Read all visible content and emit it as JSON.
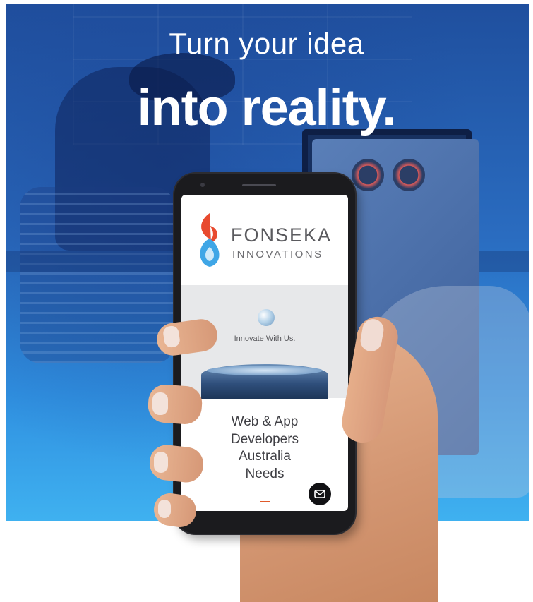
{
  "hero": {
    "line1": "Turn your idea",
    "line2": "into reality."
  },
  "phone_screen": {
    "brand_name": "FONSEKA",
    "brand_sub": "INNOVATIONS",
    "tagline": "Innovate With Us.",
    "headline_lines": [
      "Web & App",
      "Developers",
      "Australia",
      "Needs"
    ],
    "mail_icon": "mail-icon"
  },
  "colors": {
    "hero_top": "#1f4f9e",
    "hero_bottom": "#3fb1f0",
    "logo_red": "#e84a2f",
    "logo_blue": "#3fa6e6",
    "indicator": "#e05a2b",
    "text_dark": "#3f3f44"
  }
}
